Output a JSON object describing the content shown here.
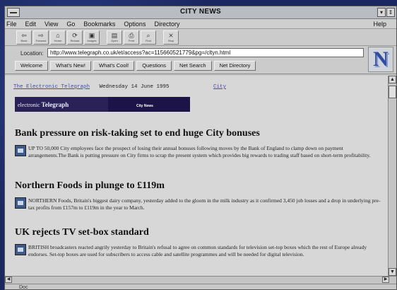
{
  "window": {
    "title": "CITY NEWS"
  },
  "titlebar_buttons": [
    "▾",
    "⇕"
  ],
  "menu": [
    "File",
    "Edit",
    "View",
    "Go",
    "Bookmarks",
    "Options",
    "Directory"
  ],
  "help": "Help",
  "toolbar": [
    {
      "icon": "back-icon",
      "glyph": "⇦",
      "label": "Back"
    },
    {
      "icon": "forward-icon",
      "glyph": "⇨",
      "label": "Forward"
    },
    {
      "icon": "home-icon",
      "glyph": "⌂",
      "label": "Home"
    },
    {
      "icon": "reload-icon",
      "glyph": "⟳",
      "label": "Reload"
    },
    {
      "icon": "images-icon",
      "glyph": "▣",
      "label": "Images"
    },
    {
      "icon": "open-icon",
      "glyph": "▤",
      "label": "Open"
    },
    {
      "icon": "print-icon",
      "glyph": "⎙",
      "label": "Print"
    },
    {
      "icon": "find-icon",
      "glyph": "⌕",
      "label": "Find"
    },
    {
      "icon": "stop-icon",
      "glyph": "⨯",
      "label": "Stop"
    }
  ],
  "location": {
    "label": "Location:",
    "url": "http://www.telegraph.co.uk/et/access?ac=115660521779&pg=/cltyn.html"
  },
  "directory_buttons": [
    "Welcome",
    "What's New!",
    "What's Cool!",
    "Questions",
    "Net Search",
    "Net Directory"
  ],
  "logo_letter": "N",
  "page": {
    "masthead_link": "The Electronic Telegraph",
    "date": "Wednesday 14 June 1995",
    "section_link": "City",
    "banner_left_small": "electronic",
    "banner_left_big": "Telegraph",
    "banner_right": "City News",
    "articles": [
      {
        "headline": "Bank pressure on risk-taking set to end huge City bonuses",
        "body": "UP TO 50,000 City employees face the prospect of losing their annual bonuses following moves by the Bank of England to clamp down on payment arrangements.The Bank is putting pressure on City firms to scrap the present system which provides big rewards to trading staff based on short-term profitability."
      },
      {
        "headline": "Northern Foods in plunge to £119m",
        "body": "NORTHERN Foods, Britain's biggest dairy company, yesterday added to the gloom in the milk industry as it confirmed 3,450 job losses and a drop in underlying pre-tax profits from £157m to £119m in the year to March."
      },
      {
        "headline": "UK rejects TV set-box standard",
        "body": "BRITISH broadcasters reacted angrily yesterday to Britain's refusal to agree on common standards for television set-top boxes which the rest of Europe already endorses. Set-top boxes are used for subscribers to access cable and satellite programmes and will be needed for digital television."
      }
    ]
  },
  "status": "Doc"
}
